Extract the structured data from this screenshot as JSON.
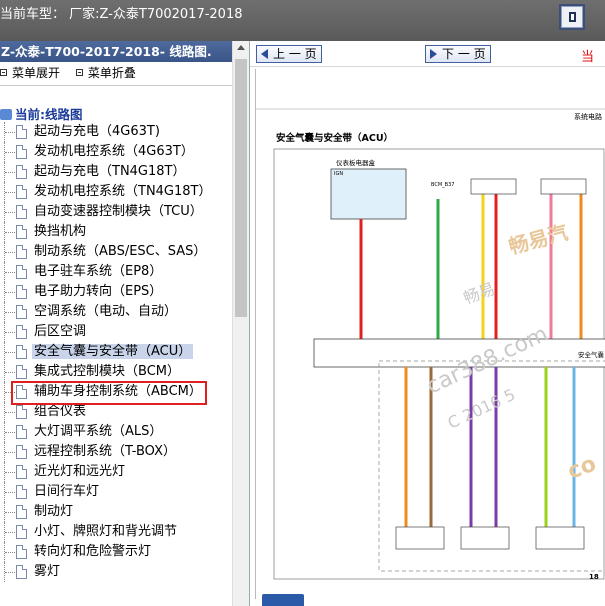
{
  "top": {
    "title": "当前车型：  厂家:Z-众泰T7002017-2018",
    "button": "toggle-icon"
  },
  "left": {
    "header": "Z-众泰-T700-2017-2018- 线路图.",
    "menu_expand": "菜单展开",
    "menu_collapse": "菜单折叠",
    "root_label": "当前:线路图",
    "items": [
      "起动与充电（4G63T)",
      "发动机电控系统（4G63T）",
      "起动与充电（TN4G18T）",
      "发动机电控系统（TN4G18T）",
      "自动变速器控制模块（TCU）",
      "换挡机构",
      "制动系统（ABS/ESC、SAS）",
      "电子驻车系统（EP8）",
      "电子助力转向（EPS）",
      "空调系统（电动、自动）",
      "后区空调",
      "安全气囊与安全带（ACU）",
      "集成式控制模块（BCM）",
      "辅助车身控制系统（ABCM）",
      "组合仪表",
      "大灯调平系统（ALS）",
      "远程控制系统（T-BOX）",
      "近光灯和远光灯",
      "日间行车灯",
      "制动灯",
      "小灯、牌照灯和背光调节",
      "转向灯和危险警示灯",
      "雾灯"
    ],
    "selected_index": 11
  },
  "right": {
    "prev_label": "上 一 页",
    "next_label": "下 一 页",
    "warn_label": "当",
    "doc": {
      "corner_label": "系统电路",
      "section_title": "安全气囊与安全带（ACU）",
      "box_label": "仪表板电器盒",
      "ign_label": "IGN",
      "bcm_label": "BCM_B37",
      "module_label": "安全气囊",
      "page_number": "18",
      "watermark_1": "畅易汽",
      "watermark_2": "畅易",
      "watermark_3": "car388.com",
      "watermark_4": "C 2016 5",
      "watermark_5": "co"
    }
  },
  "colors": {
    "accent": "#3a5587",
    "selected_bg": "#c9d4ea",
    "highlight": "#e02020",
    "wire_red": "#e02020",
    "wire_green": "#2fa84a",
    "wire_yellow": "#f2d21a",
    "wire_orange": "#f08a1c",
    "wire_purple": "#7a3aa8",
    "wire_pink": "#f07a9a",
    "wire_lime": "#9ad21a",
    "wire_blue": "#6ab6e8",
    "wire_brown": "#9a6a3a"
  }
}
